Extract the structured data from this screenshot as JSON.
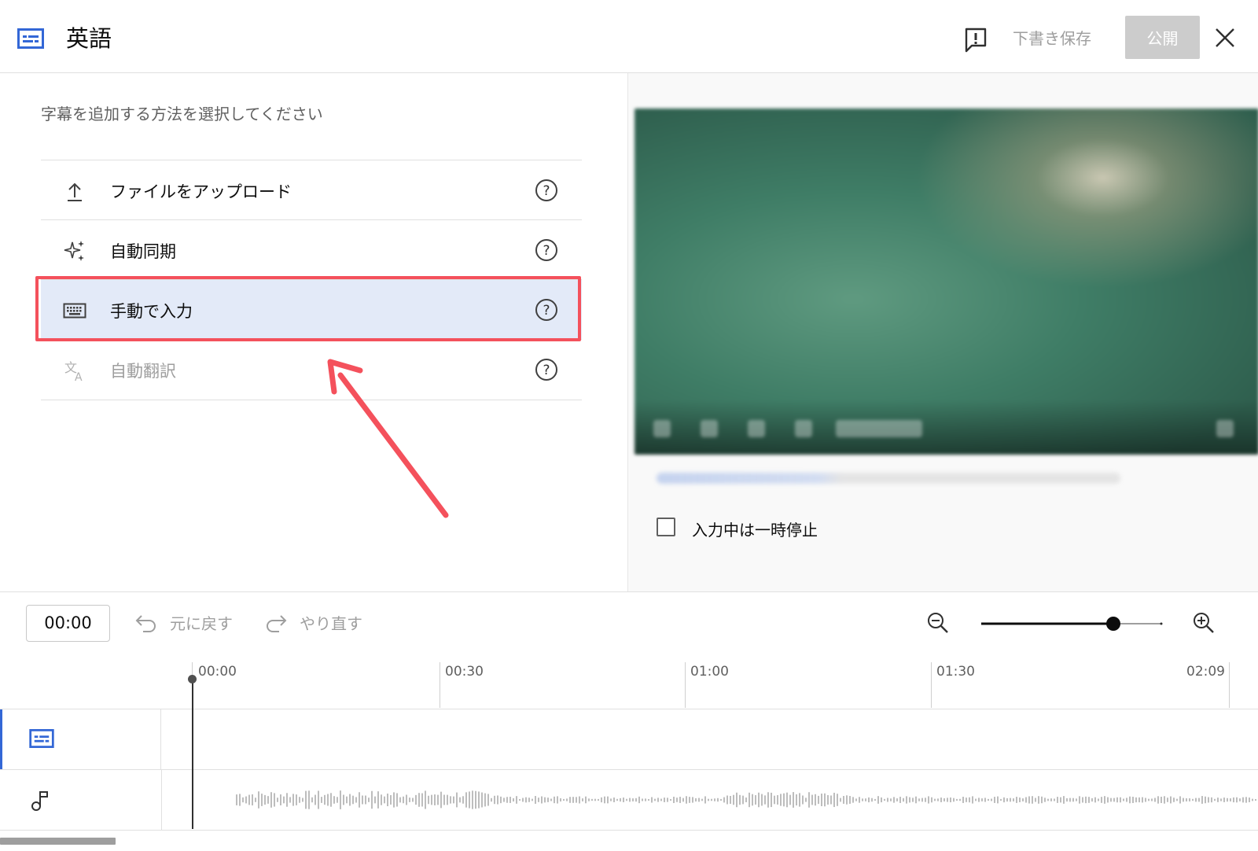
{
  "header": {
    "title": "英語",
    "draft_label": "下書き保存",
    "publish_label": "公開"
  },
  "left_panel": {
    "prompt": "字幕を追加する方法を選択してください",
    "options": [
      {
        "label": "ファイルをアップロード",
        "icon": "upload-icon",
        "state": "normal"
      },
      {
        "label": "自動同期",
        "icon": "sparkle-icon",
        "state": "normal"
      },
      {
        "label": "手動で入力",
        "icon": "keyboard-icon",
        "state": "selected"
      },
      {
        "label": "自動翻訳",
        "icon": "translate-icon",
        "state": "disabled"
      }
    ]
  },
  "right_panel": {
    "pause_label": "入力中は一時停止",
    "pause_checked": false
  },
  "toolbar": {
    "current_time": "00:00",
    "undo_label": "元に戻す",
    "redo_label": "やり直す"
  },
  "timeline": {
    "ticks": [
      "00:00",
      "00:30",
      "01:00",
      "01:30",
      "02:09"
    ]
  },
  "colors": {
    "accent_blue": "#3367d6",
    "selected_bg": "#e3eaf8",
    "highlight_red": "#f4515c",
    "publish_disabled": "#cccccc"
  }
}
